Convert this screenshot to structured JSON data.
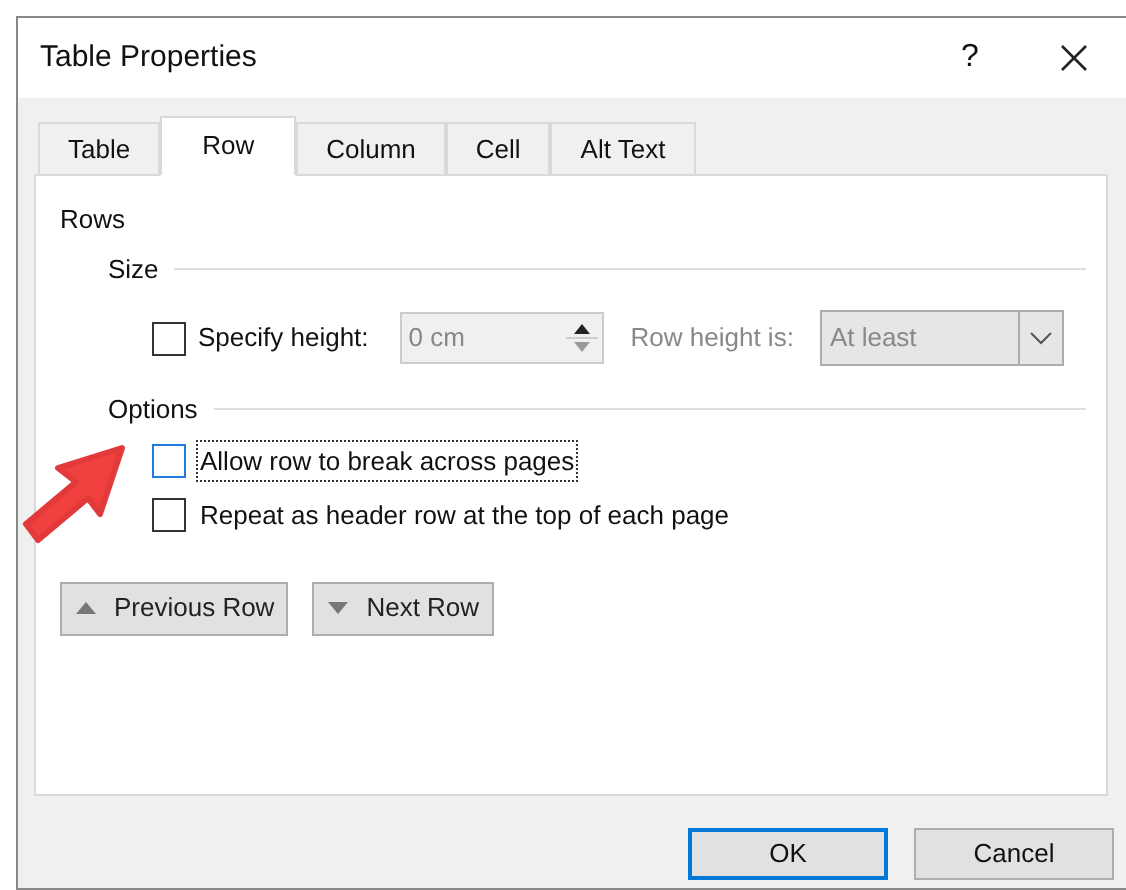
{
  "window": {
    "title": "Table Properties",
    "help": "?"
  },
  "tabs": [
    {
      "label": "Table",
      "selected": false
    },
    {
      "label": "Row",
      "selected": true
    },
    {
      "label": "Column",
      "selected": false
    },
    {
      "label": "Cell",
      "selected": false
    },
    {
      "label": "Alt Text",
      "selected": false
    }
  ],
  "section_title": "Rows",
  "size": {
    "heading": "Size",
    "specify_height": {
      "label": "Specify height:",
      "checked": false
    },
    "height_field": {
      "value": "0 cm",
      "disabled": true
    },
    "row_height_label": {
      "text": "Row height is:",
      "disabled": true
    },
    "row_height_select": {
      "value": "At least",
      "disabled": true
    }
  },
  "options": {
    "heading": "Options",
    "checkboxes": [
      {
        "label": "Allow row to break across pages",
        "checked": false,
        "focused": true
      },
      {
        "label": "Repeat as header row at the top of each page",
        "checked": false,
        "focused": false
      }
    ]
  },
  "nav_buttons": [
    {
      "label": "Previous Row",
      "kind": "up"
    },
    {
      "label": "Next Row",
      "kind": "down"
    }
  ],
  "buttons": [
    {
      "label": "OK",
      "default": true
    },
    {
      "label": "Cancel",
      "default": false
    }
  ]
}
